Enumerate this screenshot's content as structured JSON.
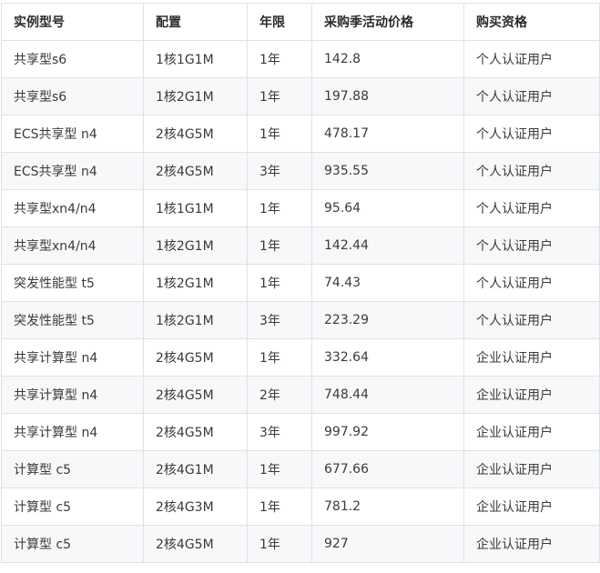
{
  "table": {
    "headers": [
      "实例型号",
      "配置",
      "年限",
      "采购季活动价格",
      "购买资格"
    ],
    "rows": [
      [
        "共享型s6",
        "1核1G1M",
        "1年",
        "142.8",
        "个人认证用户"
      ],
      [
        "共享型s6",
        "1核2G1M",
        "1年",
        "197.88",
        "个人认证用户"
      ],
      [
        "ECS共享型 n4",
        "2核4G5M",
        "1年",
        "478.17",
        "个人认证用户"
      ],
      [
        "ECS共享型 n4",
        "2核4G5M",
        "3年",
        "935.55",
        "个人认证用户"
      ],
      [
        "共享型xn4/n4",
        "1核1G1M",
        "1年",
        "95.64",
        "个人认证用户"
      ],
      [
        "共享型xn4/n4",
        "1核2G1M",
        "1年",
        "142.44",
        "个人认证用户"
      ],
      [
        "突发性能型 t5",
        "1核2G1M",
        "1年",
        "74.43",
        "个人认证用户"
      ],
      [
        "突发性能型 t5",
        "1核2G1M",
        "3年",
        "223.29",
        "个人认证用户"
      ],
      [
        "共享计算型 n4",
        "2核4G5M",
        "1年",
        "332.64",
        "企业认证用户"
      ],
      [
        "共享计算型 n4",
        "2核4G5M",
        "2年",
        "748.44",
        "企业认证用户"
      ],
      [
        "共享计算型 n4",
        "2核4G5M",
        "3年",
        "997.92",
        "企业认证用户"
      ],
      [
        "计算型 c5",
        "2核4G1M",
        "1年",
        "677.66",
        "企业认证用户"
      ],
      [
        "计算型 c5",
        "2核4G3M",
        "1年",
        "781.2",
        "企业认证用户"
      ],
      [
        "计算型 c5",
        "2核4G5M",
        "1年",
        "927",
        "企业认证用户"
      ]
    ]
  }
}
